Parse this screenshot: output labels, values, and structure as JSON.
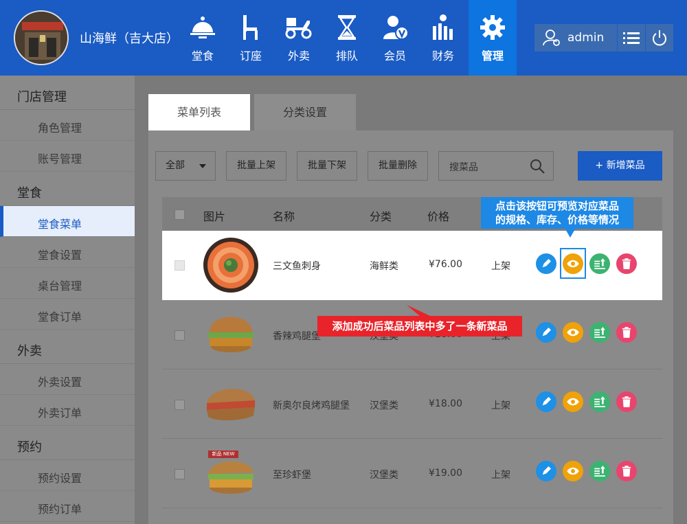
{
  "header": {
    "store_name": "山海鲜（吉大店）",
    "nav": [
      "堂食",
      "订座",
      "外卖",
      "排队",
      "会员",
      "财务",
      "管理"
    ],
    "user": "admin"
  },
  "sidebar": {
    "groups": [
      {
        "title": "门店管理",
        "items": [
          "角色管理",
          "账号管理"
        ]
      },
      {
        "title": "堂食",
        "items": [
          "堂食菜单",
          "堂食设置",
          "桌台管理",
          "堂食订单"
        ]
      },
      {
        "title": "外卖",
        "items": [
          "外卖设置",
          "外卖订单"
        ]
      },
      {
        "title": "预约",
        "items": [
          "预约设置",
          "预约订单"
        ]
      }
    ]
  },
  "tabs": [
    "菜单列表",
    "分类设置"
  ],
  "toolbar": {
    "filter": "全部",
    "batch_on": "批量上架",
    "batch_off": "批量下架",
    "batch_delete": "批量删除",
    "search_placeholder": "搜菜品",
    "add": "+ 新增菜品"
  },
  "table": {
    "headers": [
      "图片",
      "名称",
      "分类",
      "价格"
    ],
    "rows": [
      {
        "name": "三文鱼刺身",
        "category": "海鲜类",
        "price": "¥76.00",
        "status": "上架"
      },
      {
        "name": "香辣鸡腿堡",
        "category": "汉堡类",
        "price": "¥18.00",
        "status": "上架"
      },
      {
        "name": "新奥尔良烤鸡腿堡",
        "category": "汉堡类",
        "price": "¥18.00",
        "status": "上架"
      },
      {
        "name": "至珍虾堡",
        "category": "汉堡类",
        "price": "¥19.00",
        "status": "上架"
      }
    ],
    "new_badge": "新品 NEW"
  },
  "tooltips": {
    "preview_line1": "点击该按钮可预览对应菜品",
    "preview_line2": "的规格、库存、价格等情况",
    "added": "添加成功后菜品列表中多了一条新菜品"
  },
  "colors": {
    "header": "#1a5bc4",
    "edit": "#1e90e6",
    "preview": "#f0a20a",
    "sort": "#3cb371",
    "delete": "#e8456e",
    "tip_blue": "#1e88e5",
    "tip_red": "#e8232a"
  }
}
